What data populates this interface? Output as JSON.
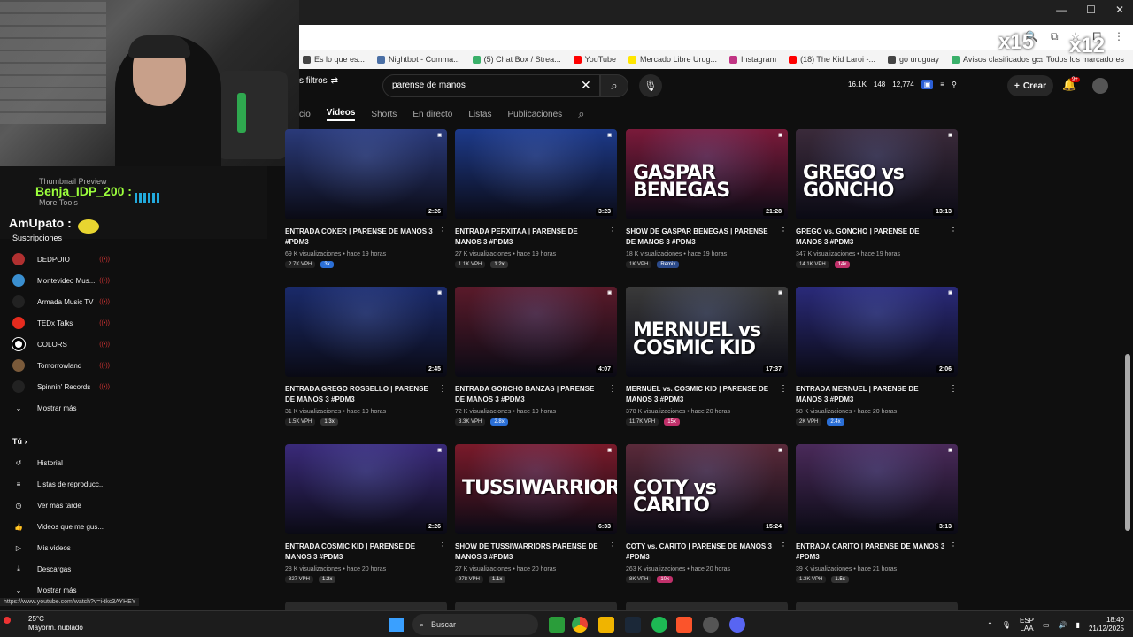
{
  "bookmarks": [
    {
      "label": "Es lo que es...",
      "color": "#444"
    },
    {
      "label": "Nightbot - Comma...",
      "color": "#4a6fa5"
    },
    {
      "label": "(5) Chat Box / Strea...",
      "color": "#3ab06a"
    },
    {
      "label": "YouTube",
      "color": "#ff0000"
    },
    {
      "label": "Mercado Libre Urug...",
      "color": "#ffe600"
    },
    {
      "label": "Instagram",
      "color": "#c13584"
    },
    {
      "label": "(18) The Kid Laroi -...",
      "color": "#ff0000"
    },
    {
      "label": "go uruguay",
      "color": "#444"
    },
    {
      "label": "Avisos clasificados g...",
      "color": "#3ab06a"
    }
  ],
  "bookmarks_all": "Todos los marcadores",
  "sticker": {
    "x15": "x15",
    "x12": "x12"
  },
  "chat": {
    "thumb_preview": "Thumbnail Preview",
    "more_tools": "More Tools",
    "user1": "Benja_IDP_200 :",
    "user2": "AmUpato :"
  },
  "header": {
    "filters": "s filtros",
    "search_value": "parense de manos",
    "stats": [
      "16.1K",
      "148",
      "12,774"
    ],
    "create": "Crear",
    "notif_count": "9+"
  },
  "tabs": [
    {
      "label": "cio",
      "active": false
    },
    {
      "label": "Videos",
      "active": true
    },
    {
      "label": "Shorts",
      "active": false
    },
    {
      "label": "En directo",
      "active": false
    },
    {
      "label": "Listas",
      "active": false
    },
    {
      "label": "Publicaciones",
      "active": false
    }
  ],
  "sidebar": {
    "subs_title": "Suscripciones",
    "subs": [
      {
        "label": "DEDPOIO",
        "color": "#b03030"
      },
      {
        "label": "Montevideo Mus...",
        "color": "#3a8fd0"
      },
      {
        "label": "Armada Music TV",
        "color": "#222"
      },
      {
        "label": "TEDx Talks",
        "color": "#e62b1e"
      },
      {
        "label": "COLORS",
        "color": "#fff"
      },
      {
        "label": "Tomorrowland",
        "color": "#7a5a3a"
      },
      {
        "label": "Spinnin' Records",
        "color": "#222"
      }
    ],
    "show_more": "Mostrar más",
    "you_title": "Tú",
    "you_items": [
      "Historial",
      "Listas de reproducc...",
      "Ver más tarde",
      "Videos que me gus...",
      "Mis videos",
      "Descargas",
      "Mostrar más"
    ]
  },
  "videos": [
    {
      "title": "ENTRADA COKER | PARENSE DE MANOS 3 #PDM3",
      "views": "69 K visualizaciones",
      "age": "hace 19 horas",
      "duration": "2:26",
      "vph": "2.7K VPH",
      "mult": "3x",
      "mult_color": "#2b6fd6",
      "thumb": "#2a3a7a",
      "big": ""
    },
    {
      "title": "ENTRADA PERXITAA | PARENSE DE MANOS 3 #PDM3",
      "views": "27 K visualizaciones",
      "age": "hace 19 horas",
      "duration": "3:23",
      "vph": "1.1K VPH",
      "mult": "1.2x",
      "mult_color": "#333",
      "thumb": "#1d3a8a",
      "big": ""
    },
    {
      "title": "SHOW DE GASPAR BENEGAS | PARENSE DE MANOS 3 #PDM3",
      "views": "18 K visualizaciones",
      "age": "hace 19 horas",
      "duration": "21:28",
      "vph": "1K VPH",
      "mult": "Remix",
      "mult_color": "#2b4a8a",
      "thumb": "#7a1a3a",
      "big": "GASPAR BENEGAS"
    },
    {
      "title": "GREGO vs. GONCHO | PARENSE DE MANOS 3 #PDM3",
      "views": "347 K visualizaciones",
      "age": "hace 19 horas",
      "duration": "13:13",
      "vph": "14.1K VPH",
      "mult": "14x",
      "mult_color": "#c0306a",
      "thumb": "#3a2a3a",
      "big": "GREGO vs GONCHO"
    },
    {
      "title": "ENTRADA GREGO ROSSELLO | PARENSE DE MANOS 3 #PDM3",
      "views": "31 K visualizaciones",
      "age": "hace 19 horas",
      "duration": "2:45",
      "vph": "1.5K VPH",
      "mult": "1.3x",
      "mult_color": "#333",
      "thumb": "#1a2a6a",
      "big": ""
    },
    {
      "title": "ENTRADA GONCHO BANZAS | PARENSE DE MANOS 3 #PDM3",
      "views": "72 K visualizaciones",
      "age": "hace 19 horas",
      "duration": "4:07",
      "vph": "3.3K VPH",
      "mult": "2.8x",
      "mult_color": "#2b6fd6",
      "thumb": "#5a1a2a",
      "big": ""
    },
    {
      "title": "MERNUEL vs. COSMIC KID | PARENSE DE MANOS 3 #PDM3",
      "views": "378 K visualizaciones",
      "age": "hace 20 horas",
      "duration": "17:37",
      "vph": "11.7K VPH",
      "mult": "15x",
      "mult_color": "#c0306a",
      "thumb": "#3a3a3a",
      "big": "MERNUEL vs COSMIC KID"
    },
    {
      "title": "ENTRADA MERNUEL | PARENSE DE MANOS 3 #PDM3",
      "views": "58 K visualizaciones",
      "age": "hace 20 horas",
      "duration": "2:06",
      "vph": "2K VPH",
      "mult": "2.4x",
      "mult_color": "#2b6fd6",
      "thumb": "#2a2a7a",
      "big": ""
    },
    {
      "title": "ENTRADA COSMIC KID | PARENSE DE MANOS 3 #PDM3",
      "views": "28 K visualizaciones",
      "age": "hace 20 horas",
      "duration": "2:26",
      "vph": "827 VPH",
      "mult": "1.2x",
      "mult_color": "#333",
      "thumb": "#3a2a7a",
      "big": ""
    },
    {
      "title": "SHOW DE TUSSIWARRIORS PARENSE DE MANOS 3 #PDM3",
      "views": "27 K visualizaciones",
      "age": "hace 20 horas",
      "duration": "6:33",
      "vph": "978 VPH",
      "mult": "1.1x",
      "mult_color": "#333",
      "thumb": "#7a1a2a",
      "big": "TUSSIWARRIORS"
    },
    {
      "title": "COTY vs. CARITO | PARENSE DE MANOS 3 #PDM3",
      "views": "263 K visualizaciones",
      "age": "hace 20 horas",
      "duration": "15:24",
      "vph": "8K VPH",
      "mult": "10x",
      "mult_color": "#c0306a",
      "thumb": "#5a2a3a",
      "big": "COTY vs CARITO"
    },
    {
      "title": "ENTRADA CARITO | PARENSE DE MANOS 3 #PDM3",
      "views": "39 K visualizaciones",
      "age": "hace 21 horas",
      "duration": "3:13",
      "vph": "1.3K VPH",
      "mult": "1.5x",
      "mult_color": "#333",
      "thumb": "#4a2a5a",
      "big": ""
    }
  ],
  "status_url": "https://www.youtube.com/watch?v=i-tkc3AYHEY",
  "taskbar": {
    "temp": "25°C",
    "weather": "Mayorm. nublado",
    "search": "Buscar",
    "lang": "ESP",
    "lang2": "LAA",
    "time": "18:40",
    "date": "21/12/2025"
  }
}
